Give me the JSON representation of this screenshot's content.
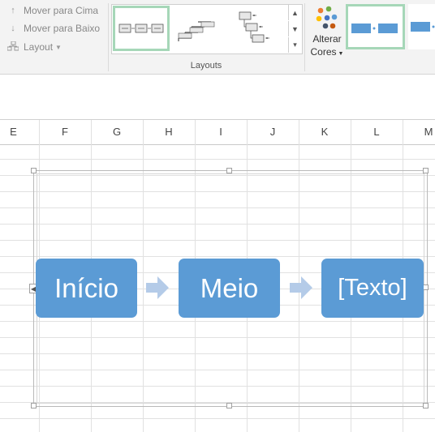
{
  "ribbon": {
    "move_up": "Mover para Cima",
    "move_down": "Mover para Baixo",
    "layout": "Layout",
    "layouts_group_label": "Layouts",
    "change_colors_line1": "Alterar",
    "change_colors_line2": "Cores"
  },
  "columns": [
    "E",
    "F",
    "G",
    "H",
    "I",
    "J",
    "K",
    "L",
    "M"
  ],
  "smartart": {
    "shapes": [
      "Início",
      "Meio",
      "[Texto]"
    ]
  },
  "colors": {
    "shape_fill": "#5b9bd5",
    "arrow_fill": "#b4cbe8",
    "selection_border": "#a6d7b8"
  }
}
